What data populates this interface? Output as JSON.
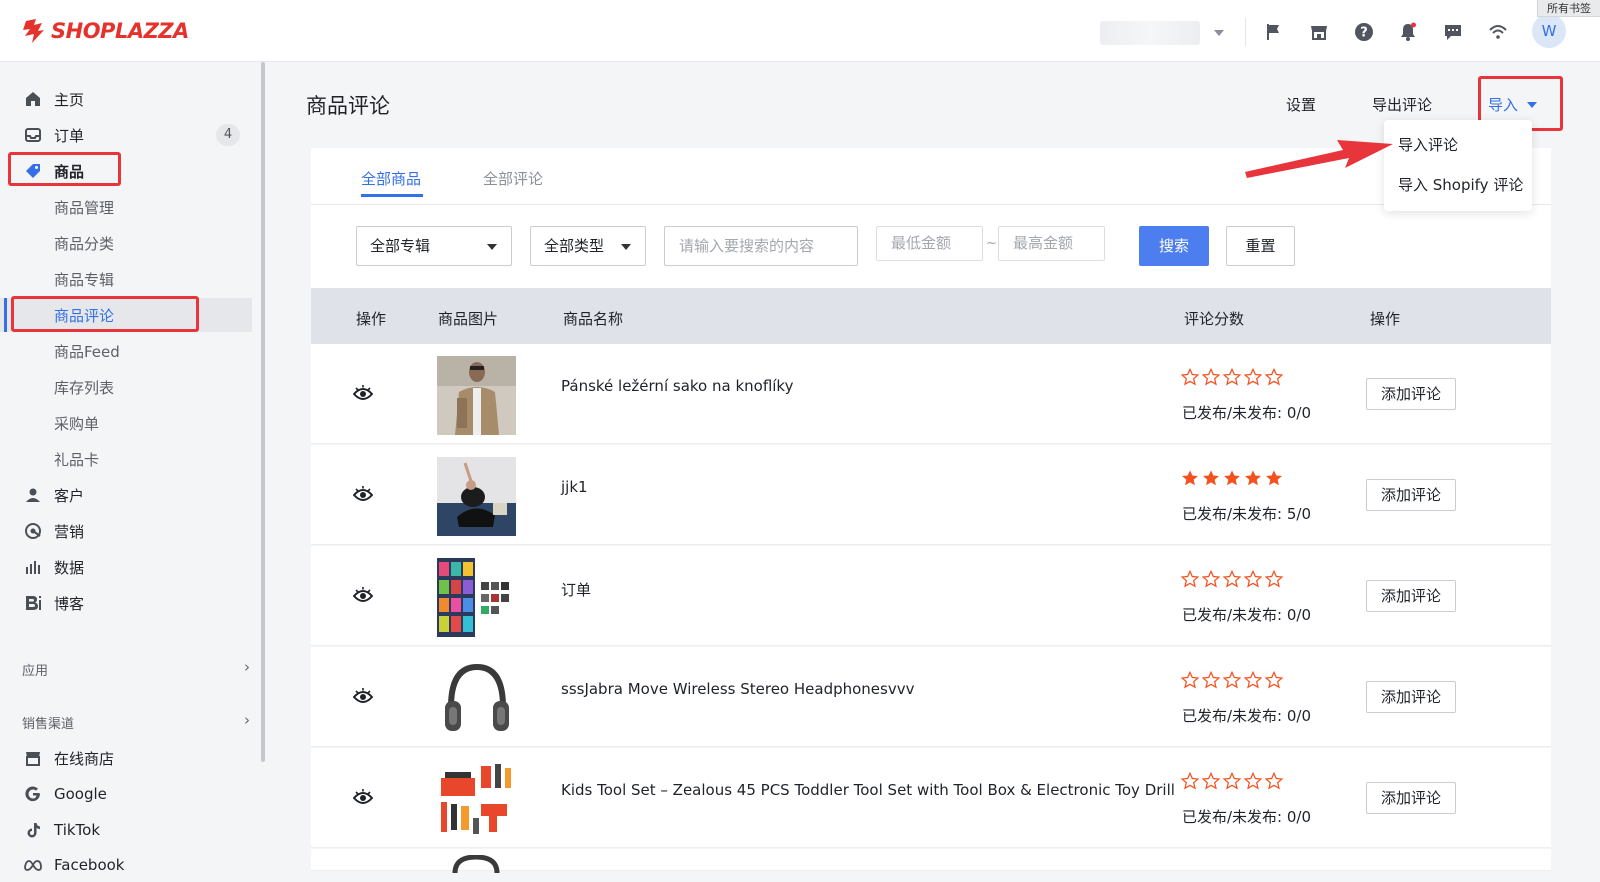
{
  "brand": {
    "name": "SHOPLAZZA"
  },
  "bookmark_label": "所有书签",
  "user": {
    "avatar_letter": "W"
  },
  "sidebar": {
    "items": [
      {
        "label": "主页",
        "icon": "home-icon"
      },
      {
        "label": "订单",
        "icon": "inbox-icon",
        "badge": "4"
      },
      {
        "label": "商品",
        "icon": "tag-icon"
      }
    ],
    "product_sub": [
      "商品管理",
      "商品分类",
      "商品专辑",
      "商品评论",
      "商品Feed",
      "库存列表",
      "采购单",
      "礼品卡"
    ],
    "more_items": [
      {
        "label": "客户",
        "icon": "person-icon"
      },
      {
        "label": "营销",
        "icon": "marketing-icon"
      },
      {
        "label": "数据",
        "icon": "bar-chart-icon"
      },
      {
        "label": "博客",
        "icon": "blog-icon"
      }
    ],
    "apps_heading": "应用",
    "channels_heading": "销售渠道",
    "channels": [
      {
        "label": "在线商店",
        "icon": "store-icon"
      },
      {
        "label": "Google",
        "icon": "google-icon"
      },
      {
        "label": "TikTok",
        "icon": "tiktok-icon"
      },
      {
        "label": "Facebook",
        "icon": "meta-icon"
      }
    ]
  },
  "page": {
    "title": "商品评论",
    "actions": {
      "settings": "设置",
      "export": "导出评论",
      "import": "导入"
    },
    "import_menu": [
      "导入评论",
      "导入 Shopify 评论"
    ],
    "tabs": [
      "全部商品",
      "全部评论"
    ]
  },
  "filters": {
    "collection": "全部专辑",
    "type": "全部类型",
    "search_placeholder": "请输入要搜索的内容",
    "min_placeholder": "最低金额",
    "range_sep": "~",
    "max_placeholder": "最高金额",
    "search_btn": "搜索",
    "reset_btn": "重置"
  },
  "table": {
    "headers": [
      "操作",
      "商品图片",
      "商品名称",
      "评论分数",
      "操作"
    ],
    "rows": [
      {
        "name": "Pánské ležérní sako na knoflíky",
        "rating": 0,
        "published": "已发布/未发布: 0/0",
        "action": "添加评论"
      },
      {
        "name": "jjk1",
        "rating": 5,
        "published": "已发布/未发布: 5/0",
        "action": "添加评论"
      },
      {
        "name": "订单",
        "rating": 0,
        "published": "已发布/未发布: 0/0",
        "action": "添加评论"
      },
      {
        "name": "sssJabra Move Wireless Stereo Headphonesvvv",
        "rating": 0,
        "published": "已发布/未发布: 0/0",
        "action": "添加评论"
      },
      {
        "name": "Kids Tool Set – Zealous 45 PCS Toddler Tool Set with Tool Box & Electronic Toy Drill",
        "rating": 0,
        "published": "已发布/未发布: 0/0",
        "action": "添加评论"
      }
    ]
  },
  "colors": {
    "accent": "#3470e6",
    "brand": "#e5322d",
    "highlight": "#e8343b",
    "star": "#f5511e"
  }
}
